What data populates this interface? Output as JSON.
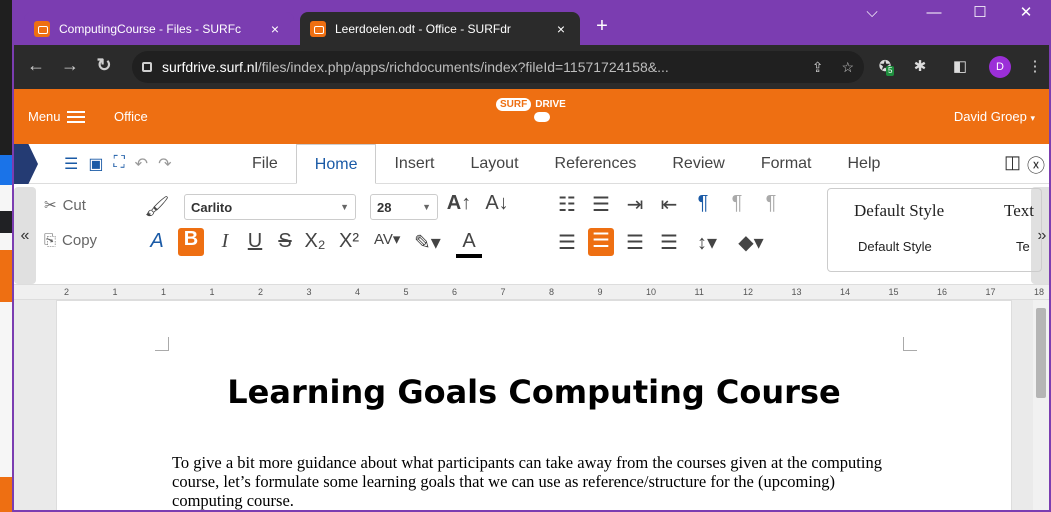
{
  "browser": {
    "tabs": [
      {
        "title": "ComputingCourse - Files - SURFc",
        "close": "×"
      },
      {
        "title": "Leerdoelen.odt - Office - SURFdr",
        "close": "×"
      }
    ],
    "new_tab": "+",
    "window_controls": {
      "minimize": "—",
      "maximize": "☐",
      "close": "✕",
      "tabsearch": "⌵"
    },
    "url_host": "surfdrive.surf.nl",
    "url_path": "/files/index.php/apps/richdocuments/index?fileId=11571724158&...",
    "profile_initial": "D",
    "ext_badge": "5"
  },
  "app": {
    "menu_label": "Menu",
    "section": "Office",
    "logo_left": "SURF",
    "logo_right": "DRIVE",
    "user": "David Groep"
  },
  "office": {
    "tabs": [
      "File",
      "Home",
      "Insert",
      "Layout",
      "References",
      "Review",
      "Format",
      "Help"
    ],
    "active_tab": "Home",
    "cut_label": "Cut",
    "copy_label": "Copy",
    "font_name": "Carlito",
    "font_size": "28",
    "style_preview_1": "Default Style",
    "style_preview_1b": "Text",
    "style_name_1": "Default Style",
    "style_name_1b": "Te"
  },
  "ruler": [
    "2",
    "1",
    "1",
    "1",
    "2",
    "3",
    "4",
    "5",
    "6",
    "7",
    "8",
    "9",
    "10",
    "11",
    "12",
    "13",
    "14",
    "15",
    "16",
    "17",
    "18"
  ],
  "document": {
    "title": "Learning Goals Computing Course",
    "paragraph": "To give a bit more guidance about what participants can take away from the courses given at the computing course, let’s formulate some learning goals that we can use as reference/structure for the (upcoming) computing course."
  },
  "colors": {
    "frame": "#7b3db1",
    "surf_orange": "#ee6f12",
    "accent_blue": "#1a5aa6"
  }
}
